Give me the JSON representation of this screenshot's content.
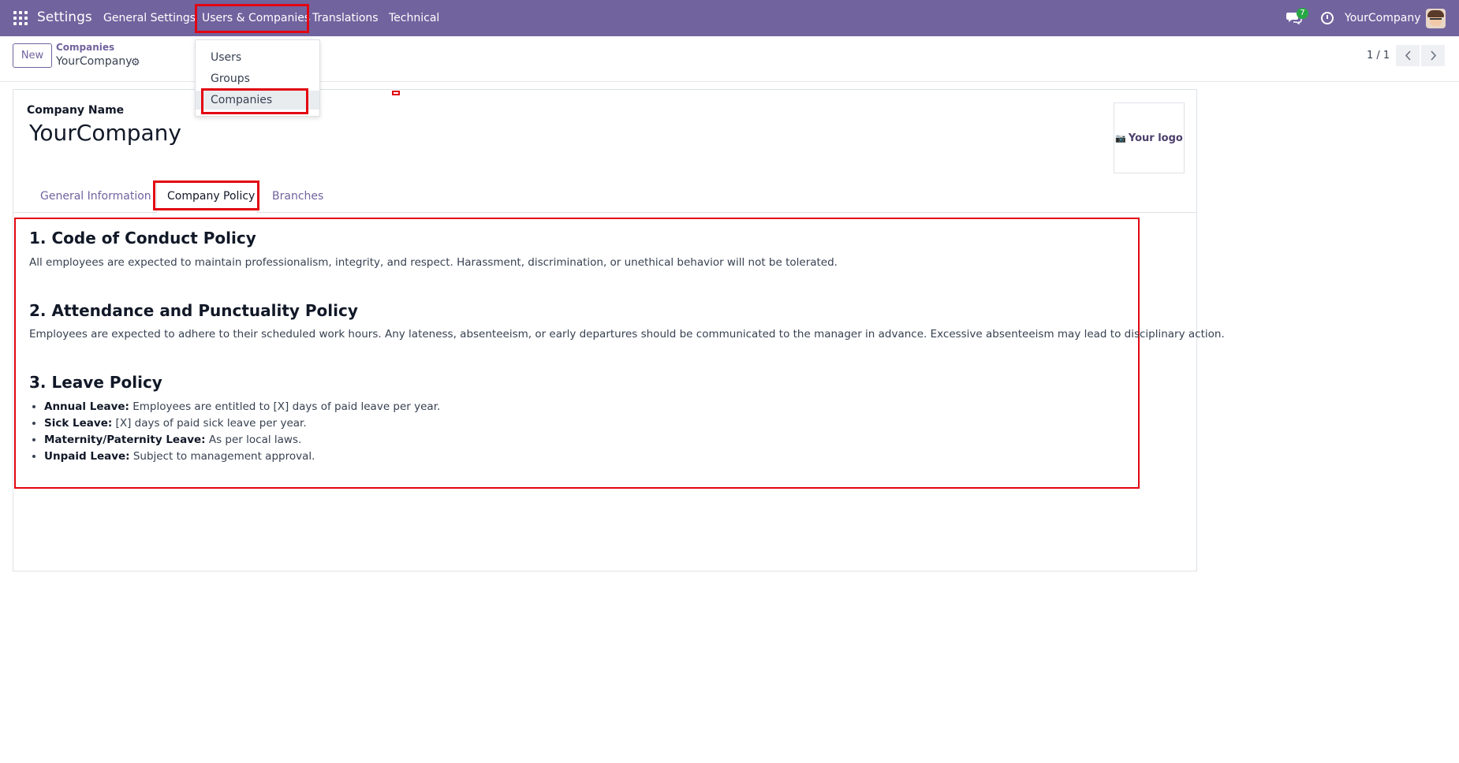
{
  "navbar": {
    "app_title": "Settings",
    "menu": [
      "General Settings",
      "Users & Companies",
      "Translations",
      "Technical"
    ],
    "chat_badge": "7",
    "company": "YourCompany"
  },
  "control_panel": {
    "new_label": "New",
    "breadcrumb_parent": "Companies",
    "breadcrumb_current": "YourCompany",
    "pager": "1 / 1"
  },
  "dropdown": {
    "items": [
      "Users",
      "Groups",
      "Companies"
    ]
  },
  "form": {
    "company_name_label": "Company Name",
    "company_name": "YourCompany",
    "logo_label": "Your logo",
    "tabs": [
      "General Information",
      "Company Policy",
      "Branches"
    ]
  },
  "policy": {
    "s1_title": "1. Code of Conduct Policy",
    "s1_text": "All employees are expected to maintain professionalism, integrity, and respect. Harassment, discrimination, or unethical behavior will not be tolerated.",
    "s2_title": "2. Attendance and Punctuality Policy",
    "s2_text": "Employees are expected to adhere to their scheduled work hours. Any lateness, absenteeism, or early departures should be communicated to the manager in advance. Excessive absenteeism may lead to disciplinary action.",
    "s3_title": "3. Leave Policy",
    "leave": [
      {
        "label": "Annual Leave:",
        "text": " Employees are entitled to [X] days of paid leave per year."
      },
      {
        "label": "Sick Leave:",
        "text": " [X] days of paid sick leave per year."
      },
      {
        "label": "Maternity/Paternity Leave:",
        "text": " As per local laws."
      },
      {
        "label": "Unpaid Leave:",
        "text": " Subject to management approval."
      }
    ]
  },
  "colors": {
    "navbar": "#71639e",
    "highlight": "#e20612"
  }
}
